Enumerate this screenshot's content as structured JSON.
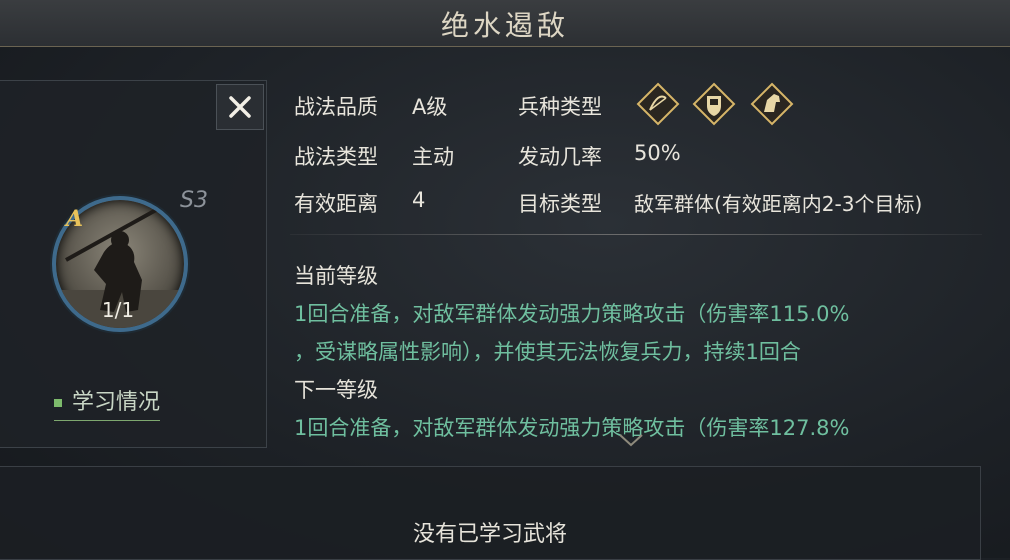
{
  "title": "绝水遏敌",
  "close_icon": "close-icon",
  "grade": "A",
  "season": "S3",
  "count": "1/1",
  "learn_status_label": "学习情况",
  "attrs": {
    "quality_label": "战法品质",
    "quality_value": "A级",
    "troop_label": "兵种类型",
    "type_label": "战法类型",
    "type_value": "主动",
    "rate_label": "发动几率",
    "rate_value": "50%",
    "range_label": "有效距离",
    "range_value": "4",
    "target_label": "目标类型",
    "target_value": "敌军群体(有效距离内2-3个目标)"
  },
  "troop_icons": [
    "archer-icon",
    "shield-icon",
    "cavalry-icon"
  ],
  "current_level": {
    "heading": "当前等级",
    "line1": "1回合准备，对敌军群体发动强力策略攻击（伤害率115.0%",
    "line2": "，受谋略属性影响），并使其无法恢复兵力，持续1回合"
  },
  "next_level": {
    "heading": "下一等级",
    "line1": "1回合准备，对敌军群体发动强力策略攻击（伤害率127.8%"
  },
  "no_generals": "没有已学习武将",
  "colors": {
    "accent_gold": "#e8c25a",
    "desc_green": "#6fbf9f",
    "portrait_ring": "#3e6a8c"
  }
}
